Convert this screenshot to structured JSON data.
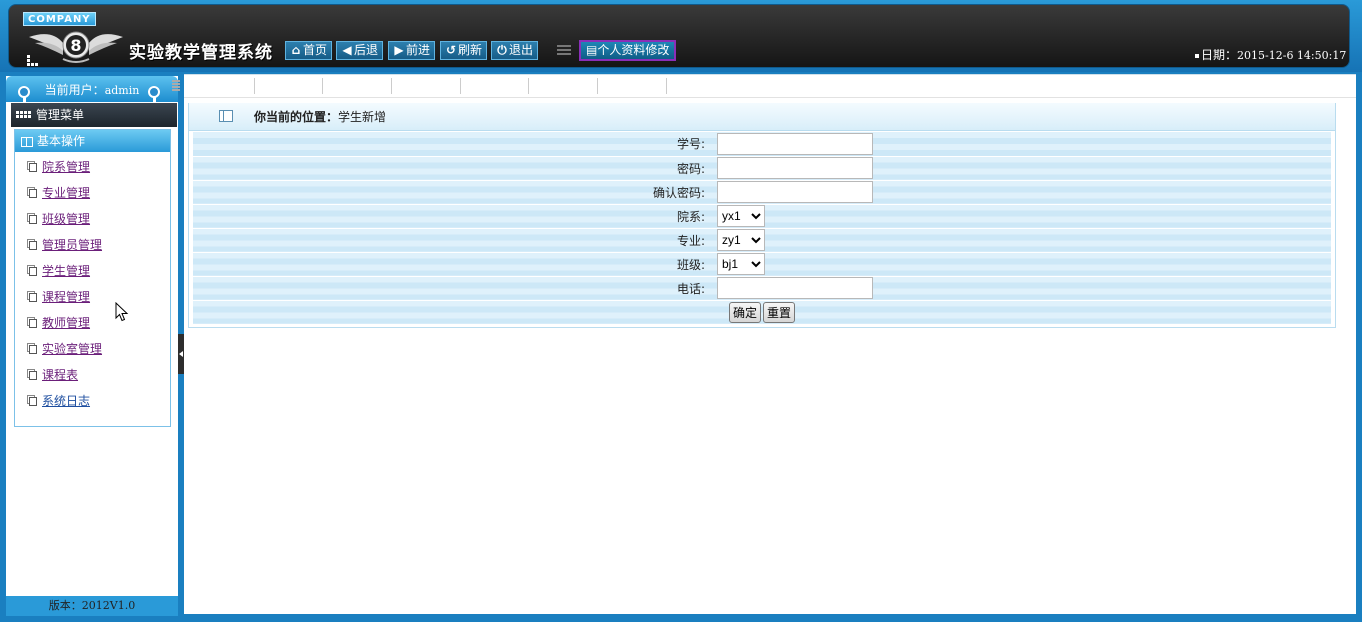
{
  "header": {
    "company_label": "COMPANY",
    "logo_text": "8",
    "app_title": "实验教学管理系统",
    "nav": [
      {
        "icon": "home-icon",
        "glyph": "⌂",
        "label": "首页"
      },
      {
        "icon": "back-icon",
        "glyph": "◀",
        "label": "后退"
      },
      {
        "icon": "forward-icon",
        "glyph": "▶",
        "label": "前进"
      },
      {
        "icon": "refresh-icon",
        "glyph": "↺",
        "label": "刷新"
      },
      {
        "icon": "power-icon",
        "glyph": "⏻",
        "label": "退出"
      }
    ],
    "profile_label": "个人资料修改",
    "date_label": "日期：",
    "date_value": "2015-12-6 14:50:17"
  },
  "sidebar": {
    "user_label": "当前用户：",
    "user_name": "admin",
    "menu_title": "管理菜单",
    "section_title": "基本操作",
    "items": [
      {
        "label": "院系管理"
      },
      {
        "label": "专业管理"
      },
      {
        "label": "班级管理"
      },
      {
        "label": "管理员管理"
      },
      {
        "label": "学生管理"
      },
      {
        "label": "课程管理"
      },
      {
        "label": "教师管理"
      },
      {
        "label": "实验室管理"
      },
      {
        "label": "课程表"
      },
      {
        "label": "系统日志"
      }
    ],
    "version": "版本：2012V1.0"
  },
  "main": {
    "location_label": "你当前的位置：",
    "location_value": "学生新增",
    "form": {
      "student_id_label": "学号:",
      "student_id_value": "",
      "password_label": "密码:",
      "password_value": "",
      "confirm_label": "确认密码:",
      "confirm_value": "",
      "dept_label": "院系:",
      "dept_value": "yx1",
      "major_label": "专业:",
      "major_value": "zy1",
      "class_label": "班级:",
      "class_value": "bj1",
      "phone_label": "电话:",
      "phone_value": "",
      "submit_label": "确定",
      "reset_label": "重置"
    }
  },
  "colors": {
    "brand_blue": "#1a7fc0",
    "header_dark": "#151515",
    "menu_link": "#6b1f7a"
  }
}
